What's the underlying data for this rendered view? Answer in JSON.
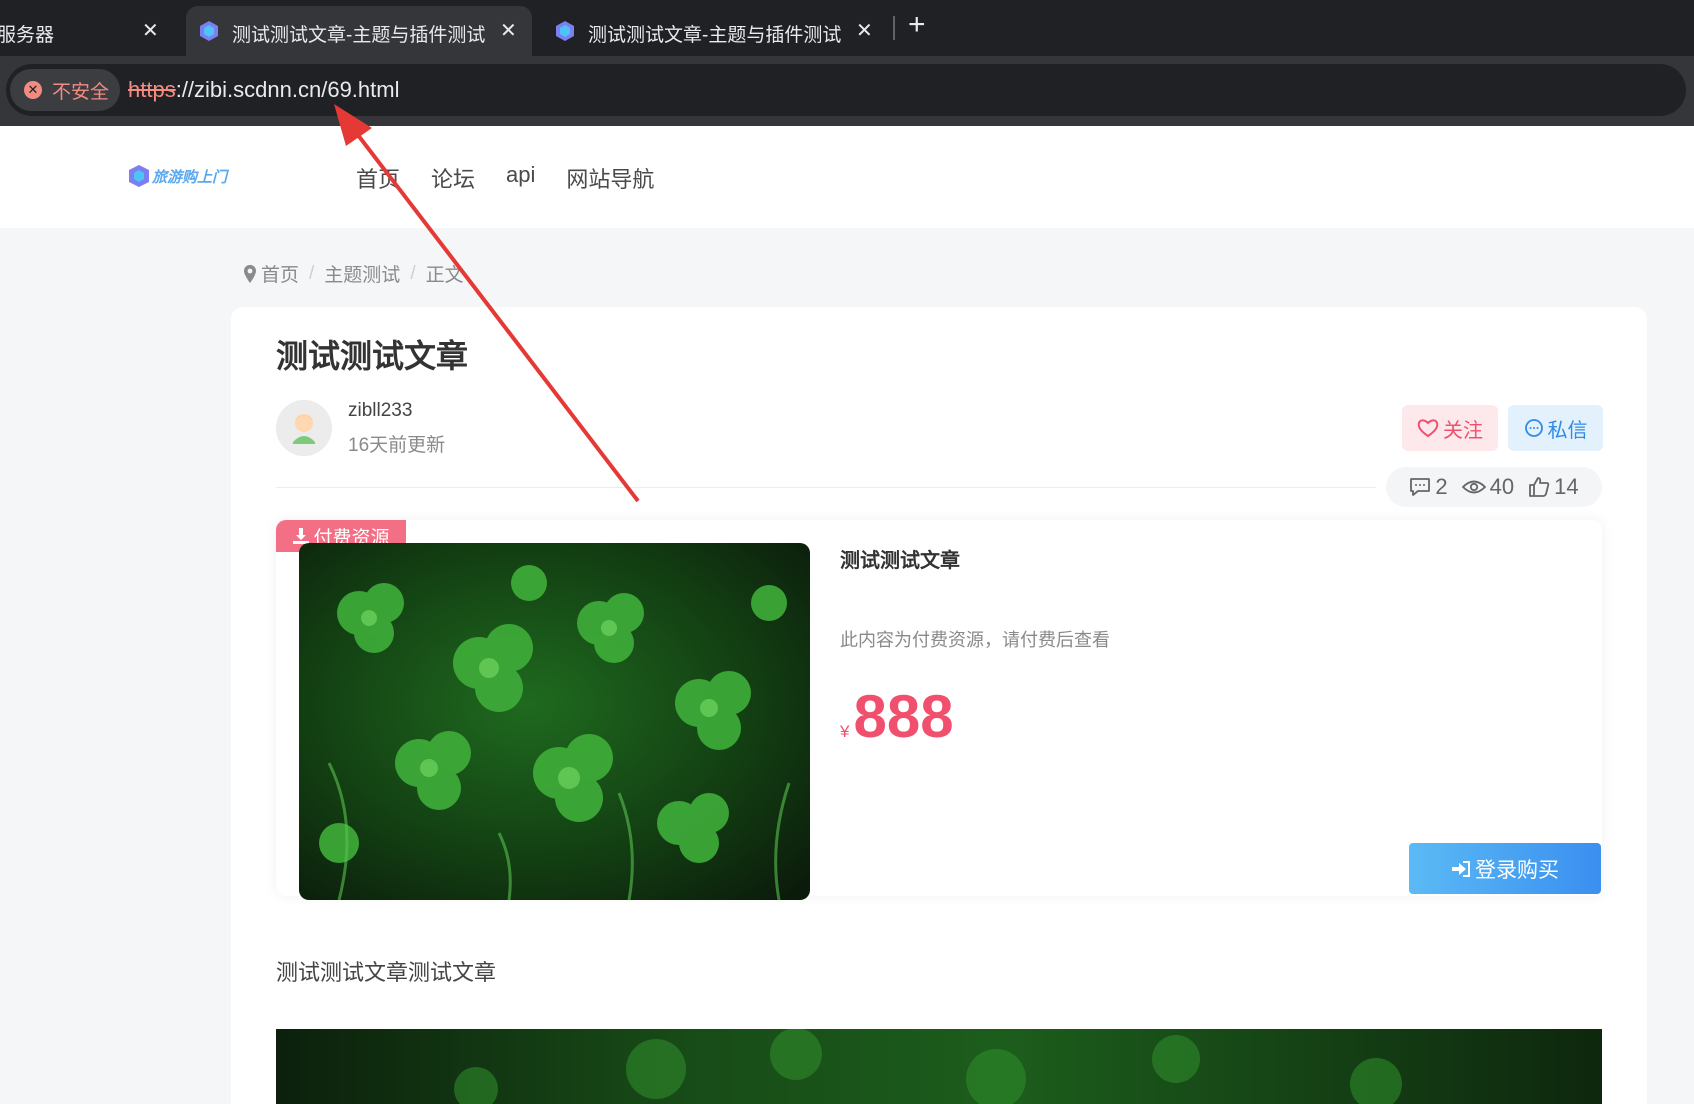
{
  "browser": {
    "tabs": [
      {
        "title": "服务器",
        "close": "✕"
      },
      {
        "title": "测试测试文章-主题与插件测试",
        "close": "✕"
      },
      {
        "title": "测试测试文章-主题与插件测试",
        "close": "✕"
      }
    ],
    "new_tab": "+",
    "security_label": "不安全",
    "url_scheme": "https",
    "url_rest": "://zibi.scdnn.cn/69.html"
  },
  "site": {
    "logo_text": "旅游购上门",
    "nav": [
      "首页",
      "论坛",
      "api",
      "网站导航"
    ]
  },
  "breadcrumb": [
    "首页",
    "主题测试",
    "正文"
  ],
  "article": {
    "title": "测试测试文章",
    "author": "zibll233",
    "updated": "16天前更新",
    "follow_label": "关注",
    "message_label": "私信",
    "stats": {
      "comments": "2",
      "views": "40",
      "likes": "14"
    },
    "paid": {
      "badge": "付费资源",
      "title": "测试测试文章",
      "description": "此内容为付费资源，请付费后查看",
      "currency": "¥",
      "price": "888",
      "buy_label": "登录购买"
    },
    "body_text": "测试测试文章测试文章"
  },
  "colors": {
    "accent_pink": "#f0506e",
    "accent_blue": "#2f8be6",
    "chrome_dark": "#202124",
    "annotation_red": "#e53935"
  }
}
